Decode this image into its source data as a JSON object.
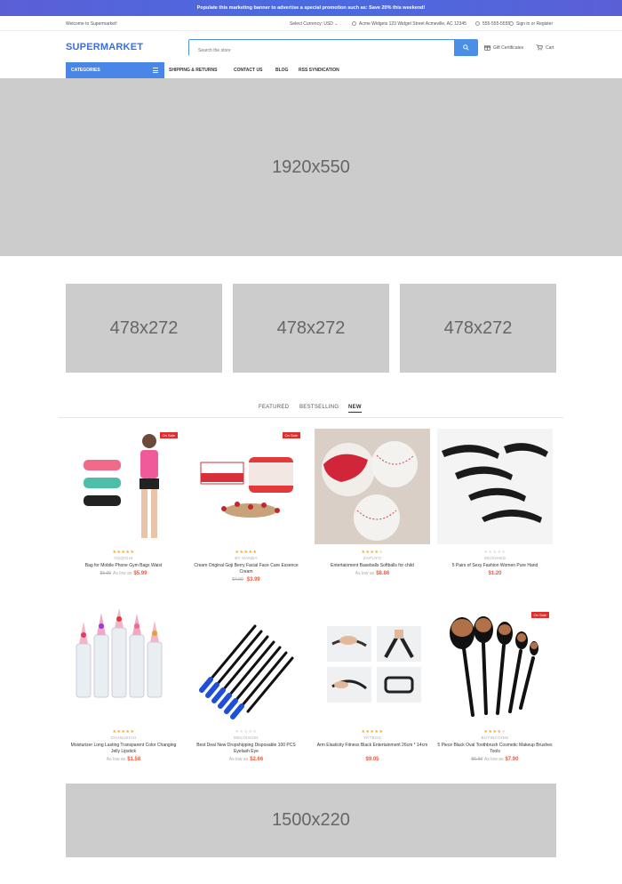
{
  "promo": {
    "text": "Populate this marketing banner to advertise a special promotion such as: Save 20% this weekend!"
  },
  "topbar": {
    "welcome": "Welcome to Supermarket!",
    "currency": "Select Currency: USD",
    "address": "Acme Widgets 123 Widget Street Acmeville, AC 12345",
    "phone": "555-555-5555",
    "signin": "Sign in or Register"
  },
  "header": {
    "logo": "SUPERMARKET",
    "search_placeholder": "Search the store",
    "gift": "Gift Certificates",
    "cart": "Cart"
  },
  "nav": {
    "categories": "CATEGORIES",
    "links": [
      "SHIPPING & RETURNS",
      "CONTACT US",
      "BLOG",
      "RSS SYNDICATION"
    ]
  },
  "banners": {
    "hero": "1920x550",
    "small": [
      "478x272",
      "478x272",
      "478x272"
    ],
    "bottom": "1500x220"
  },
  "tabs": [
    "FEATURED",
    "BESTSELLING",
    "NEW"
  ],
  "products": [
    {
      "brand": "OXQIGHI",
      "name": "Bag for Mobile Phone Gym Bags Waist",
      "old": "$6.00",
      "as_low": "As low as",
      "price": "$5.99",
      "sale": "On Sale",
      "stars": 5
    },
    {
      "brand": "BY NANDA",
      "name": "Cream Original Goji Berry Facial Face Care Essence Cream",
      "old": "$4.90",
      "as_low": "",
      "price": "$3.99",
      "sale": "On Sale",
      "stars": 5
    },
    {
      "brand": "ZAPUYO",
      "name": "Entertainment Baseballs Softballs for child",
      "old": "",
      "as_low": "As low as",
      "price": "$8.86",
      "sale": "",
      "stars": 4
    },
    {
      "brand": "SKONHED",
      "name": "5 Pairs of Sexy Fashion Women Pure Hand",
      "old": "",
      "as_low": "",
      "price": "$1.20",
      "sale": "",
      "stars": 0
    },
    {
      "brand": "CHANLECHI",
      "name": "Moisturizer Long Lasting Transparent Color Changing Jelly Lipstick",
      "old": "",
      "as_low": "As low as",
      "price": "$1.58",
      "sale": "",
      "stars": 5
    },
    {
      "brand": "MELOISION",
      "name": "Best Deal New Dropshipping Disposable 100 PCS Eyelash Eye",
      "old": "",
      "as_low": "As low as",
      "price": "$2.66",
      "sale": "",
      "stars": 0
    },
    {
      "brand": "YKTEOS",
      "name": "Arm Elasticity Fitness Black Entertainment 26cm * 14cm",
      "old": "",
      "as_low": "",
      "price": "$9.05",
      "sale": "",
      "stars": 5
    },
    {
      "brand": "BUYINCOINS",
      "name": "5 Piece Black Oval Toothbrush Cosmetic Makeup Brushes Tools",
      "old": "$6.90",
      "as_low": "As low as",
      "price": "$7.90",
      "sale": "On Sale",
      "stars": 4
    }
  ],
  "colors": {
    "accent": "#4a86e8",
    "price": "#f05a3c",
    "sale": "#e02d2d",
    "promo": "#5b5fd6",
    "star": "#f5a623"
  }
}
